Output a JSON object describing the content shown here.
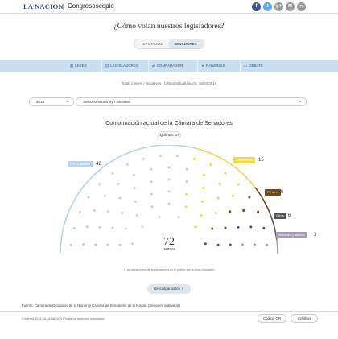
{
  "header": {
    "logo": "LA NACION",
    "app": "Congresoscopio",
    "social": [
      {
        "name": "facebook-icon",
        "glyph": "f",
        "color": "#3b5998"
      },
      {
        "name": "twitter-icon",
        "glyph": "t",
        "color": "#55acee"
      },
      {
        "name": "gplus-icon",
        "glyph": "g+",
        "color": "#999999"
      },
      {
        "name": "email-icon",
        "glyph": "✉",
        "color": "#999999"
      },
      {
        "name": "link-icon",
        "glyph": "∞",
        "color": "#999999"
      }
    ]
  },
  "question": "¿Cómo votan nuestros legisladores?",
  "toggle": {
    "diputados": "DIPUTADOS",
    "senadores": "SENADORES"
  },
  "nav": [
    {
      "label": "LEYES",
      "icon": "▦"
    },
    {
      "label": "LEGISLADORES",
      "icon": "▤"
    },
    {
      "label": "COMPARADOR",
      "icon": "⇄"
    },
    {
      "label": "RANKINGS",
      "icon": "★"
    },
    {
      "label": "DEBATE",
      "icon": "▭"
    }
  ],
  "status": "Total: 1 leyes / iniciativas - Última actualización: 16/03/2016",
  "year_select": "2016",
  "law_select": "Seleccione una ley / iniciativa",
  "chart_title": "Conformación actual de la Cámara de Senadores",
  "quorum": "Quórum: 37",
  "total_seats": "72",
  "seats_label": "bancas",
  "blocs": [
    {
      "name": "FPV y aliados",
      "count": "42",
      "color": "#b7d3ea"
    },
    {
      "name": "Cambiemos",
      "count": "15",
      "color": "#ecd84e"
    },
    {
      "name": "PJ no K",
      "count": "6",
      "color": "#6b4a16"
    },
    {
      "name": "Otros",
      "count": "6",
      "color": "#555555"
    },
    {
      "name": "Misiones y aliados",
      "count": "3",
      "color": "#a59bb5"
    }
  ],
  "note": "* Las ubicaciones de los senadores en el gráfico son a modo ilustrativo",
  "download": "Descargar datos",
  "source": "Fuente: Cámara de Diputados de la Nación y Cámara de Senadores de la Nación (Sesiones ordinarias)",
  "copyright": "Copyright 2016 SA LA NACION | Todos los derechos reservados",
  "footer_buttons": [
    "Código QR",
    "Créditos"
  ]
}
